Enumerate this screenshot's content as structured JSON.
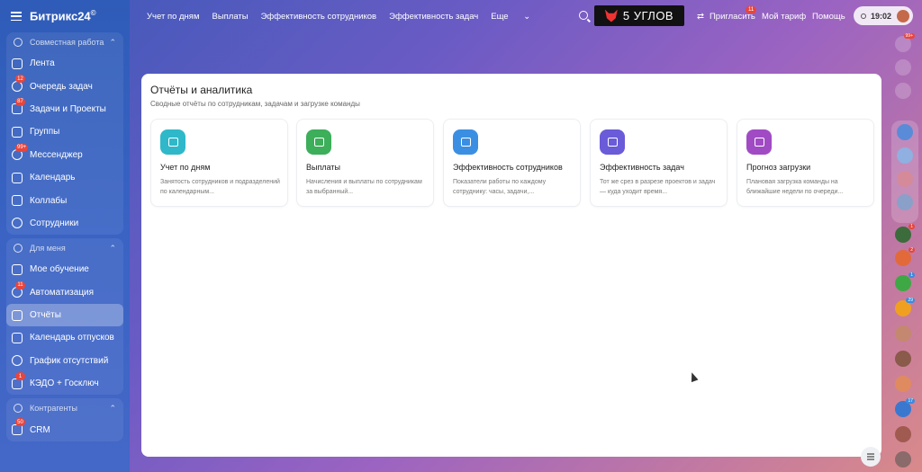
{
  "brand": {
    "name": "Битрикс24",
    "mark": "©"
  },
  "topnav": [
    "Учет по дням",
    "Выплаты",
    "Эффективность сотрудников",
    "Эффективность задач",
    "Еще"
  ],
  "banner": "5 УГЛОВ",
  "header": {
    "invite": "Пригласить",
    "invite_badge": "11",
    "tariff": "Мой тариф",
    "help": "Помощь",
    "time": "19:02"
  },
  "sidebar": {
    "groups": [
      {
        "label": "Совместная работа",
        "items": [
          {
            "label": "Лента",
            "badge": ""
          },
          {
            "label": "Очередь задач",
            "badge": "12"
          },
          {
            "label": "Задачи и Проекты",
            "badge": "87"
          },
          {
            "label": "Группы",
            "badge": ""
          },
          {
            "label": "Мессенджер",
            "badge": "99+"
          },
          {
            "label": "Календарь",
            "badge": ""
          },
          {
            "label": "Коллабы",
            "badge": ""
          },
          {
            "label": "Сотрудники",
            "badge": ""
          }
        ]
      },
      {
        "label": "Для меня",
        "items": [
          {
            "label": "Мое обучение",
            "badge": ""
          },
          {
            "label": "Автоматизация",
            "badge": "11"
          },
          {
            "label": "Отчёты",
            "badge": "",
            "active": true
          },
          {
            "label": "Календарь отпусков",
            "badge": ""
          },
          {
            "label": "График отсутствий",
            "badge": ""
          },
          {
            "label": "КЭДО + Госключ",
            "badge": "1"
          }
        ]
      },
      {
        "label": "Контрагенты",
        "items": [
          {
            "label": "CRM",
            "badge": "50"
          }
        ]
      }
    ]
  },
  "main": {
    "title": "Отчёты и аналитика",
    "subtitle": "Сводные отчёты по сотрудникам, задачам и загрузке команды",
    "cards": [
      {
        "title": "Учет по дням",
        "desc": "Занятость сотрудников и подразделений по календарным...",
        "color": "#2fb8c9"
      },
      {
        "title": "Выплаты",
        "desc": "Начисления и выплаты по сотрудникам за выбранный...",
        "color": "#3dae5a"
      },
      {
        "title": "Эффективность сотрудников",
        "desc": "Показатели работы по каждому сотруднику: часы, задачи,...",
        "color": "#3b8fe3"
      },
      {
        "title": "Эффективность задач",
        "desc": "Тот же срез в разрезе проектов и задач — куда уходит время...",
        "color": "#6a5bd8"
      },
      {
        "title": "Прогноз загрузки",
        "desc": "Плановая загрузка команды на ближайшие недели по очереди...",
        "color": "#a04bc4"
      }
    ]
  },
  "rail": {
    "badges": [
      "99+",
      "1",
      "2",
      "1",
      "29",
      "17"
    ]
  }
}
